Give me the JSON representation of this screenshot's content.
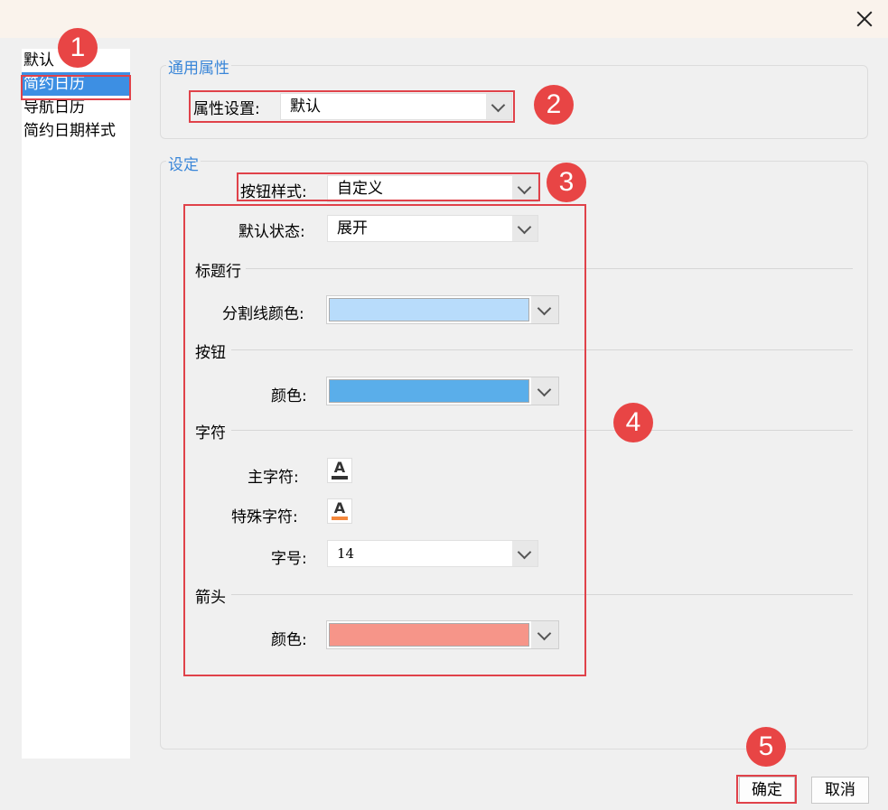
{
  "sidebar": {
    "items": [
      {
        "label": "默认"
      },
      {
        "label": "简约日历"
      },
      {
        "label": "导航日历"
      },
      {
        "label": "简约日期样式"
      }
    ]
  },
  "general": {
    "title": "通用属性",
    "property_label": "属性设置:",
    "property_value": "默认"
  },
  "settings": {
    "title": "设定",
    "button_style_label": "按钮样式:",
    "button_style_value": "自定义",
    "default_state_label": "默认状态:",
    "default_state_value": "展开",
    "title_row_section": "标题行",
    "divider_color_label": "分割线颜色:",
    "divider_color": "#b8dcfb",
    "button_section": "按钮",
    "button_color_label": "颜色:",
    "button_color": "#5aaeea",
    "char_section": "字符",
    "main_char_label": "主字符:",
    "main_char_glyph": "A",
    "main_char_color": "#333333",
    "special_char_label": "特殊字符:",
    "special_char_glyph": "A",
    "special_char_color": "#f4883c",
    "font_size_label": "字号:",
    "font_size_value": "14",
    "arrow_section": "箭头",
    "arrow_color_label": "颜色:",
    "arrow_color": "#f69589"
  },
  "footer": {
    "ok_label": "确定",
    "cancel_label": "取消"
  },
  "annotations": {
    "badge1": "1",
    "badge2": "2",
    "badge3": "3",
    "badge4": "4",
    "badge5": "5",
    "color": "#e84545"
  }
}
